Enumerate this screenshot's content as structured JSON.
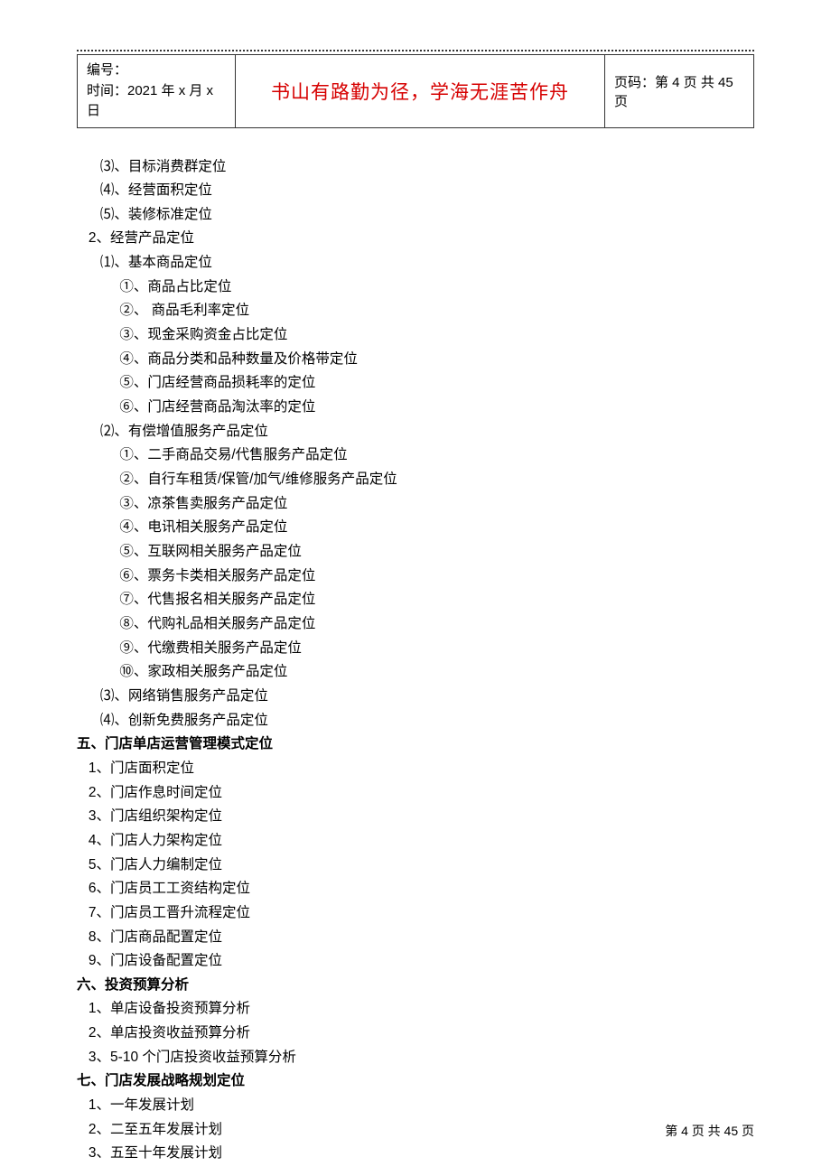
{
  "header": {
    "left_line1": "编号：",
    "left_line2": "时间：2021 年 x 月 x 日",
    "slogan": "书山有路勤为径，学海无涯苦作舟",
    "page_label": "页码：第 4 页  共 45 页"
  },
  "lines": [
    {
      "indent": 3,
      "text": "⑶、目标消费群定位"
    },
    {
      "indent": 3,
      "text": "⑷、经营面积定位"
    },
    {
      "indent": 3,
      "text": "⑸、装修标准定位"
    },
    {
      "indent": 2,
      "text": "2、经营产品定位"
    },
    {
      "indent": 3,
      "text": "⑴、基本商品定位"
    },
    {
      "indent": 4,
      "text": "①、商品占比定位"
    },
    {
      "indent": 4,
      "text": "②、 商品毛利率定位"
    },
    {
      "indent": 4,
      "text": "③、现金采购资金占比定位"
    },
    {
      "indent": 4,
      "text": "④、商品分类和品种数量及价格带定位"
    },
    {
      "indent": 4,
      "text": "⑤、门店经营商品损耗率的定位"
    },
    {
      "indent": 4,
      "text": "⑥、门店经营商品淘汰率的定位"
    },
    {
      "indent": 3,
      "text": "⑵、有偿增值服务产品定位"
    },
    {
      "indent": 4,
      "text": "①、二手商品交易/代售服务产品定位"
    },
    {
      "indent": 4,
      "text": "②、自行车租赁/保管/加气/维修服务产品定位"
    },
    {
      "indent": 4,
      "text": "③、凉茶售卖服务产品定位"
    },
    {
      "indent": 4,
      "text": "④、电讯相关服务产品定位"
    },
    {
      "indent": 4,
      "text": "⑤、互联网相关服务产品定位"
    },
    {
      "indent": 4,
      "text": "⑥、票务卡类相关服务产品定位"
    },
    {
      "indent": 4,
      "text": "⑦、代售报名相关服务产品定位"
    },
    {
      "indent": 4,
      "text": "⑧、代购礼品相关服务产品定位"
    },
    {
      "indent": 4,
      "text": "⑨、代缴费相关服务产品定位"
    },
    {
      "indent": 4,
      "text": "⑩、家政相关服务产品定位"
    },
    {
      "indent": 3,
      "text": "⑶、网络销售服务产品定位"
    },
    {
      "indent": 3,
      "text": "⑷、创新免费服务产品定位"
    },
    {
      "indent": 1,
      "text": "五、门店单店运营管理模式定位",
      "bold": true
    },
    {
      "indent": 2,
      "text": "1、门店面积定位"
    },
    {
      "indent": 2,
      "text": "2、门店作息时间定位"
    },
    {
      "indent": 2,
      "text": "3、门店组织架构定位"
    },
    {
      "indent": 2,
      "text": "4、门店人力架构定位"
    },
    {
      "indent": 2,
      "text": "5、门店人力编制定位"
    },
    {
      "indent": 2,
      "text": "6、门店员工工资结构定位"
    },
    {
      "indent": 2,
      "text": "7、门店员工晋升流程定位"
    },
    {
      "indent": 2,
      "text": "8、门店商品配置定位"
    },
    {
      "indent": 2,
      "text": "9、门店设备配置定位"
    },
    {
      "indent": 1,
      "text": "六、投资预算分析",
      "bold": true
    },
    {
      "indent": 2,
      "text": "1、单店设备投资预算分析"
    },
    {
      "indent": 2,
      "text": "2、单店投资收益预算分析"
    },
    {
      "indent": 2,
      "text": "3、5-10 个门店投资收益预算分析"
    },
    {
      "indent": 1,
      "text": "七、门店发展战略规划定位",
      "bold": true
    },
    {
      "indent": 2,
      "text": "1、一年发展计划"
    },
    {
      "indent": 2,
      "text": "2、二至五年发展计划"
    },
    {
      "indent": 2,
      "text": "3、五至十年发展计划"
    }
  ],
  "footer": "第  4  页  共  45  页"
}
